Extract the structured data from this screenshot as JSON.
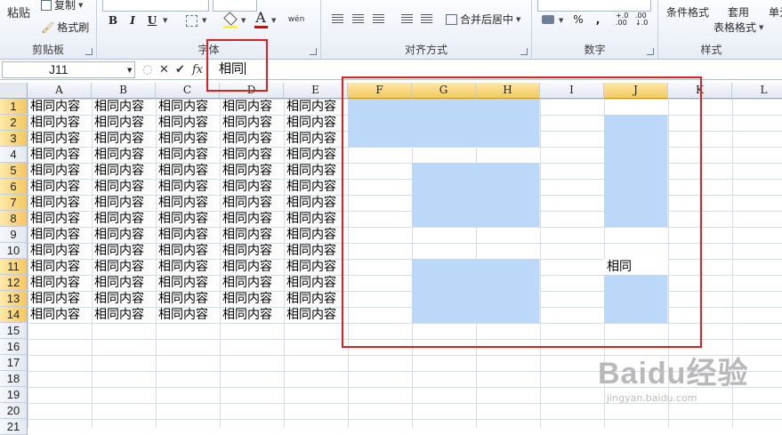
{
  "ribbon": {
    "clipboard": {
      "paste": "粘贴",
      "copy": "复制",
      "format_painter": "格式刷",
      "label": "剪贴板"
    },
    "font": {
      "bold": "B",
      "italic": "I",
      "underline": "U",
      "label": "字体",
      "font_color_glyph": "A",
      "phonetic_glyph": "wén"
    },
    "alignment": {
      "merge_center": "合并后居中",
      "label": "对齐方式"
    },
    "number": {
      "percent": "%",
      "comma": ",",
      "inc_decimal": "+.0 .00",
      "dec_decimal": ".00 ↓.0",
      "label": "数字"
    },
    "styles": {
      "conditional": "条件格式",
      "apply": "套用",
      "table_format": "表格格式",
      "cell_styles": "单元",
      "label": "样式"
    }
  },
  "formula_bar": {
    "name_box": "J11",
    "fx": "fx",
    "cancel": "✕",
    "enter": "✔",
    "content": "相同"
  },
  "columns": [
    "A",
    "B",
    "C",
    "D",
    "E",
    "F",
    "G",
    "H",
    "I",
    "J",
    "K",
    "L"
  ],
  "rows": [
    "1",
    "2",
    "3",
    "4",
    "5",
    "6",
    "7",
    "8",
    "9",
    "10",
    "11",
    "12",
    "13",
    "14",
    "15",
    "16",
    "17",
    "18",
    "19",
    "20",
    "21"
  ],
  "cell_text": "相同内容",
  "j11_text": "相同",
  "filled_rows": 14,
  "watermark": {
    "main": "Baidu经验",
    "sub": "jingyan.baidu.com"
  },
  "colors": {
    "selection": "#bcd8f8",
    "annotation": "#e02020",
    "header_selected": "#f5c862"
  }
}
